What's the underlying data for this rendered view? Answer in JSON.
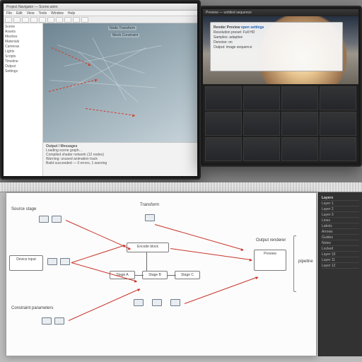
{
  "top_left": {
    "title": "Project Navigator — Scene.anim",
    "menus": [
      "File",
      "Edit",
      "View",
      "Tools",
      "Window",
      "Help"
    ],
    "toolbar": [
      "new",
      "open",
      "save",
      "undo",
      "redo",
      "play",
      "stop",
      "grid",
      "snap",
      "render"
    ],
    "tree": [
      "Scene",
      "Assets",
      "Meshes",
      "Materials",
      "Cameras",
      "Lights",
      "Scripts",
      "Timeline",
      "Output",
      "Settings"
    ],
    "viewport_labels": [
      "Node.Transform",
      "Mesh.Constraint"
    ],
    "log_tab": "Output / Messages",
    "log_lines": [
      "Loading scene graph…",
      "Compiled shader network (12 nodes)",
      "Warning: unused animation track",
      "Build succeeded — 0 errors, 1 warning"
    ]
  },
  "top_right": {
    "title": "Preview — untitled sequence",
    "popup": {
      "heading": "Render Preview",
      "link": "open settings",
      "lines": [
        "Resolution preset: Full HD",
        "Samples: adaptive",
        "Denoise: on",
        "Output: image sequence"
      ]
    }
  },
  "right_panel": {
    "heading": "Layers",
    "rows": [
      "Layer 1",
      "Layer 2",
      "Layer 3",
      "Lines",
      "Labels",
      "Arrows",
      "Guides",
      "Notes",
      "Locked",
      "Layer 10",
      "Layer 11",
      "Layer 12"
    ]
  },
  "canvas": {
    "group_left_top": "Source stage",
    "group_left_mid": "Device input",
    "group_left_bot": "Constraint parameters",
    "center_top": "Transform",
    "center_mid": "Encode block",
    "center_row": [
      "Stage A",
      "Stage B",
      "Stage C"
    ],
    "right_label": "Output renderer",
    "right_sub": "Preview",
    "brace_label": "pipeline"
  }
}
